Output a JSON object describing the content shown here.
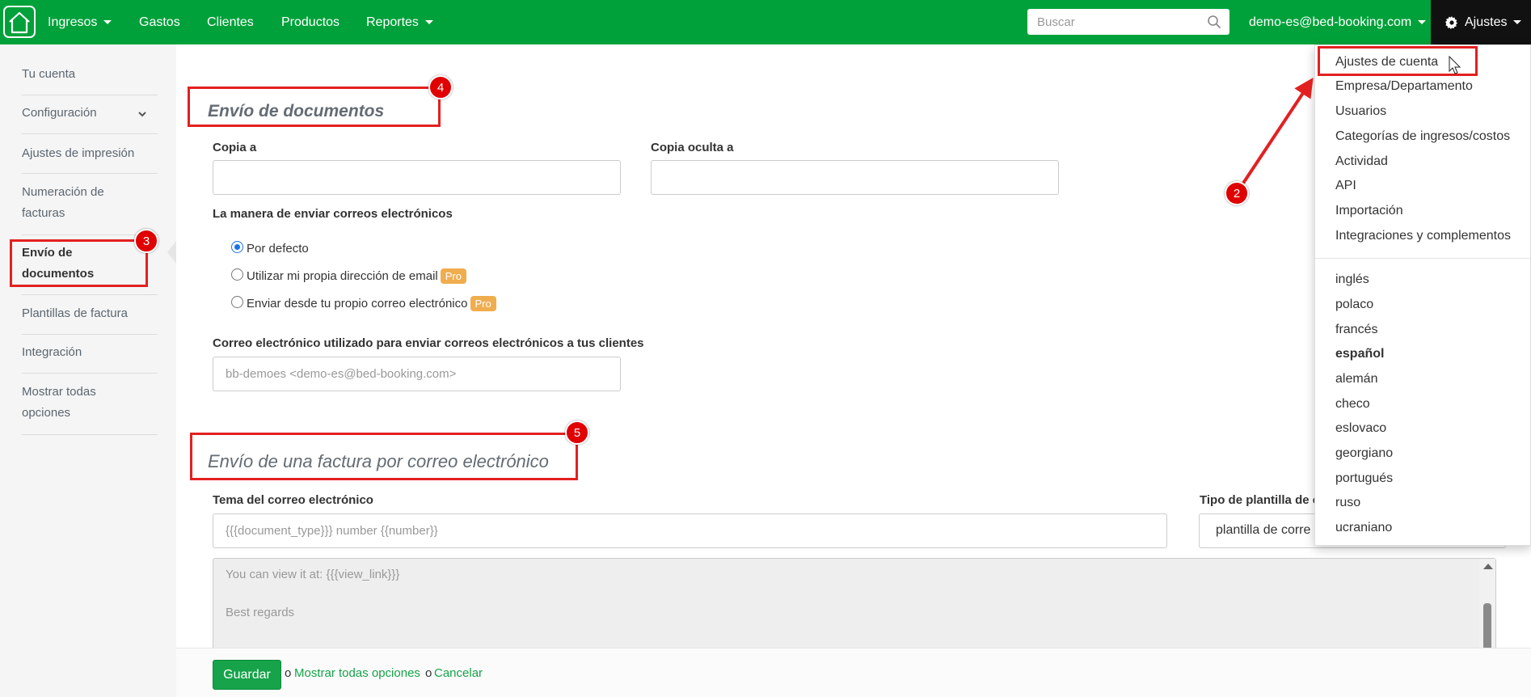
{
  "topbar": {
    "nav": [
      {
        "label": "Ingresos",
        "dropdown": true
      },
      {
        "label": "Gastos",
        "dropdown": false
      },
      {
        "label": "Clientes",
        "dropdown": false
      },
      {
        "label": "Productos",
        "dropdown": false
      },
      {
        "label": "Reportes",
        "dropdown": true
      }
    ],
    "search_placeholder": "Buscar",
    "account": "demo-es@bed-booking.com",
    "settings_label": "Ajustes",
    "bar_color": "#00a13a"
  },
  "sidebar": {
    "items": [
      {
        "label": "Tu cuenta"
      },
      {
        "label": "Configuración"
      },
      {
        "label": "Ajustes de impresión"
      },
      {
        "label": "Numeración de facturas"
      },
      {
        "label": "Envío de documentos"
      },
      {
        "label": "Plantillas de factura"
      },
      {
        "label": "Integración"
      },
      {
        "label": "Mostrar todas opciones"
      }
    ]
  },
  "main": {
    "section1_title": "Envío de documentos",
    "copy_to_label": "Copia a",
    "bcc_label": "Copia oculta a",
    "method_label": "La manera de enviar correos electrónicos",
    "radios": [
      {
        "label": "Por defecto",
        "checked": true,
        "pro": false
      },
      {
        "label": "Utilizar mi propia dirección de email",
        "checked": false,
        "pro": true
      },
      {
        "label": "Enviar desde tu propio correo electrónico",
        "checked": false,
        "pro": true
      }
    ],
    "pro_label": "Pro",
    "sender_label": "Correo electrónico utilizado para enviar correos electrónicos a tus clientes",
    "sender_placeholder": "bb-demoes <demo-es@bed-booking.com>",
    "section2_title": "Envío de una factura por correo electrónico",
    "subject_label": "Tema del correo electrónico",
    "subject_placeholder": "{{{document_type}}} number {{number}}",
    "template_type_label": "Tipo de plantilla de c",
    "template_type_value": "plantilla de corre",
    "body_lines": [
      "You can view it at: {{{view_link}}}",
      "Best regards"
    ]
  },
  "footer": {
    "save": "Guardar",
    "or1": "o",
    "show_all": "Mostrar todas opciones",
    "or2": "o",
    "cancel": "Cancelar"
  },
  "dropdown": {
    "settings": [
      "Ajustes de cuenta",
      "Empresa/Departamento",
      "Usuarios",
      "Categorías de ingresos/costos",
      "Actividad",
      "API",
      "Importación",
      "Integraciones y complementos"
    ],
    "languages": [
      "inglés",
      "polaco",
      "francés",
      "español",
      "alemán",
      "checo",
      "eslovaco",
      "georgiano",
      "portugués",
      "ruso",
      "ucraniano"
    ],
    "selected_language": "español"
  },
  "annotations": [
    "2",
    "3",
    "4",
    "5"
  ],
  "colors": {
    "accent_green": "#16a34a",
    "annotation_red": "#e32020"
  }
}
